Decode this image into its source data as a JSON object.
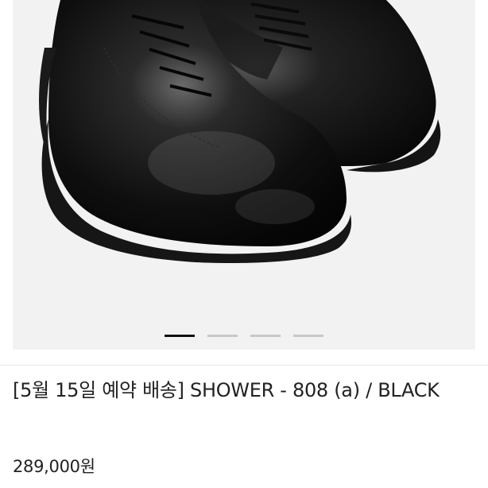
{
  "product": {
    "image": {
      "semantic": "black-leather-derby-shoes-photo",
      "background": "#f2f2f2"
    },
    "carousel": {
      "total_slides": 4,
      "active_index": 0,
      "colors": {
        "active": "#111111",
        "inactive": "#c9c9c9"
      }
    },
    "title": "[5월 15일 예약 배송] SHOWER - 808 (a) / BLACK",
    "price": "289,000원"
  }
}
